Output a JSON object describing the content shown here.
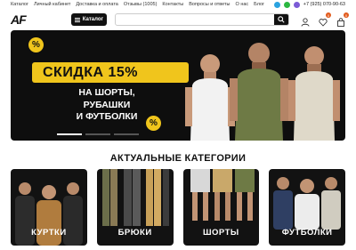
{
  "topnav": {
    "links": [
      "Каталог",
      "Личный кабинет",
      "Доставка и оплата",
      "Отзывы (1005)",
      "Контакты",
      "Вопросы и ответы",
      "О нас",
      "Блог"
    ],
    "phone": "+7 (925) 070-90-63"
  },
  "header": {
    "logo": "AF",
    "catalog_label": "Каталог",
    "search_placeholder": "",
    "favorites_count": "0",
    "cart_count": "0"
  },
  "hero": {
    "discount": "СКИДКА 15%",
    "line1": "НА ШОРТЫ, РУБАШКИ",
    "line2": "И ФУТБОЛКИ",
    "pct": "%",
    "slide_count": 3,
    "active_slide": 1
  },
  "section": {
    "title": "АКТУАЛЬНЫЕ КАТЕГОРИИ"
  },
  "categories": [
    {
      "label": "КУРТКИ"
    },
    {
      "label": "БРЮКИ"
    },
    {
      "label": "ШОРТЫ"
    },
    {
      "label": "ФУТБОЛКИ"
    }
  ],
  "colors": {
    "accent": "#f0c51c",
    "badge": "#e25b1d",
    "dark": "#111111"
  }
}
